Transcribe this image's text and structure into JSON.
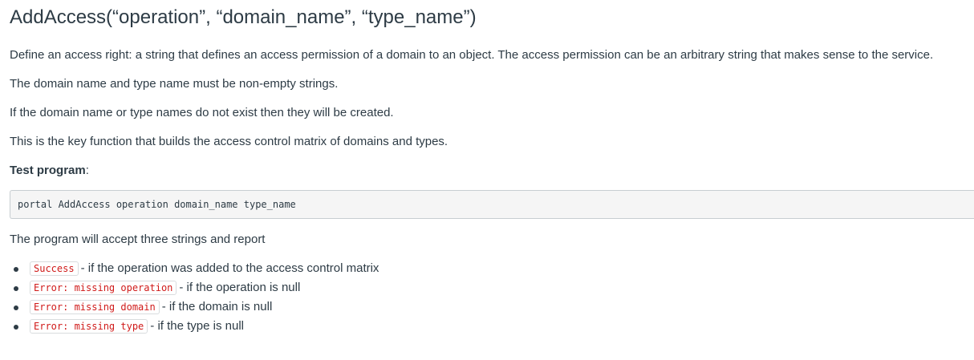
{
  "heading": "AddAccess(“operation”, “domain_name”, “type_name”)",
  "paragraphs": [
    "Define an access right: a string that defines an access permission of a domain to an object. The access permission can be an arbitrary string that makes sense to the service.",
    "The domain name and type name must be non-empty strings.",
    "If the domain name or type names do not exist then they will be created.",
    "This is the key function that builds the access control matrix of domains and types."
  ],
  "test_program": {
    "label": "Test program",
    "suffix": ":",
    "command": "portal AddAccess operation domain_name type_name"
  },
  "report_intro": "The program will accept three strings and report",
  "results": [
    {
      "code": "Success",
      "text": "- if the operation was added to the access control matrix"
    },
    {
      "code": "Error: missing operation",
      "text": "- if the operation is null"
    },
    {
      "code": "Error: missing domain",
      "text": "- if the domain is null"
    },
    {
      "code": "Error: missing type",
      "text": "- if the type is null"
    }
  ],
  "colors": {
    "text": "#2d3b45",
    "code_text": "#d01a19",
    "code_block_bg": "#f5f5f5",
    "border": "#c7cdd1"
  }
}
